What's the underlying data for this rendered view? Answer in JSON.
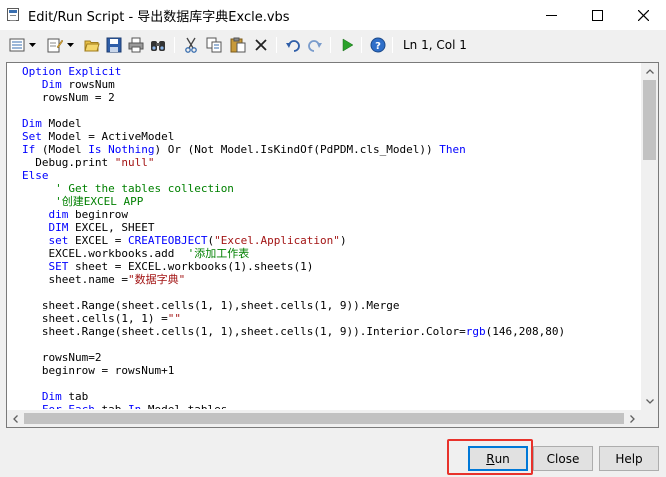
{
  "window": {
    "title": "Edit/Run Script - 导出数据库字典Excle.vbs"
  },
  "toolbar": {
    "cursor_position": "Ln 1, Col 1"
  },
  "editor": {
    "lines": [
      [
        {
          "t": "Option Explicit",
          "c": "kw"
        }
      ],
      [
        {
          "t": "   "
        },
        {
          "t": "Dim",
          "c": "kw"
        },
        {
          "t": " rowsNum"
        }
      ],
      [
        {
          "t": "   rowsNum = 2"
        }
      ],
      [
        {
          "t": ""
        }
      ],
      [
        {
          "t": "Dim",
          "c": "kw"
        },
        {
          "t": " Model"
        }
      ],
      [
        {
          "t": "Set",
          "c": "kw"
        },
        {
          "t": " Model = ActiveModel"
        }
      ],
      [
        {
          "t": "If",
          "c": "kw"
        },
        {
          "t": " (Model "
        },
        {
          "t": "Is Nothing",
          "c": "kw"
        },
        {
          "t": ") Or (Not Model.IsKindOf(PdPDM.cls_Model)) "
        },
        {
          "t": "Then",
          "c": "kw"
        }
      ],
      [
        {
          "t": "  Debug.print "
        },
        {
          "t": "\"null\"",
          "c": "str"
        }
      ],
      [
        {
          "t": "Else",
          "c": "kw"
        }
      ],
      [
        {
          "t": "     "
        },
        {
          "t": "' Get the tables collection",
          "c": "cm"
        }
      ],
      [
        {
          "t": "     "
        },
        {
          "t": "'创建EXCEL APP",
          "c": "cm"
        }
      ],
      [
        {
          "t": "    "
        },
        {
          "t": "dim",
          "c": "kw"
        },
        {
          "t": " beginrow"
        }
      ],
      [
        {
          "t": "    "
        },
        {
          "t": "DIM",
          "c": "kw"
        },
        {
          "t": " EXCEL, SHEET"
        }
      ],
      [
        {
          "t": "    "
        },
        {
          "t": "set",
          "c": "kw"
        },
        {
          "t": " EXCEL = "
        },
        {
          "t": "CREATEOBJECT",
          "c": "kw"
        },
        {
          "t": "("
        },
        {
          "t": "\"Excel.Application\"",
          "c": "str"
        },
        {
          "t": ")"
        }
      ],
      [
        {
          "t": "    EXCEL.workbooks.add  "
        },
        {
          "t": "'添加工作表",
          "c": "cm"
        }
      ],
      [
        {
          "t": "    "
        },
        {
          "t": "SET",
          "c": "kw"
        },
        {
          "t": " sheet = EXCEL.workbooks(1).sheets(1)"
        }
      ],
      [
        {
          "t": "    sheet.name ="
        },
        {
          "t": "\"数据字典\"",
          "c": "str"
        }
      ],
      [
        {
          "t": ""
        }
      ],
      [
        {
          "t": "   sheet.Range(sheet.cells(1, 1),sheet.cells(1, 9)).Merge"
        }
      ],
      [
        {
          "t": "   sheet.cells(1, 1) ="
        },
        {
          "t": "\"\"",
          "c": "str"
        }
      ],
      [
        {
          "t": "   sheet.Range(sheet.cells(1, 1),sheet.cells(1, 9)).Interior.Color="
        },
        {
          "t": "rgb",
          "c": "kw"
        },
        {
          "t": "(146,208,80)"
        }
      ],
      [
        {
          "t": ""
        }
      ],
      [
        {
          "t": "   rowsNum=2"
        }
      ],
      [
        {
          "t": "   beginrow = rowsNum+1"
        }
      ],
      [
        {
          "t": ""
        }
      ],
      [
        {
          "t": "   "
        },
        {
          "t": "Dim",
          "c": "kw"
        },
        {
          "t": " tab"
        }
      ],
      [
        {
          "t": "   "
        },
        {
          "t": "For Each",
          "c": "kw"
        },
        {
          "t": " tab "
        },
        {
          "t": "In",
          "c": "kw"
        },
        {
          "t": " Model.tables"
        }
      ]
    ]
  },
  "buttons": {
    "run": {
      "label": "Run",
      "accel": "R",
      "rest": "un"
    },
    "close": "Close",
    "help": "Help"
  },
  "colors": {
    "keyword": "#0000ff",
    "string": "#a31515",
    "comment": "#008000",
    "highlight": "#e8322b"
  }
}
